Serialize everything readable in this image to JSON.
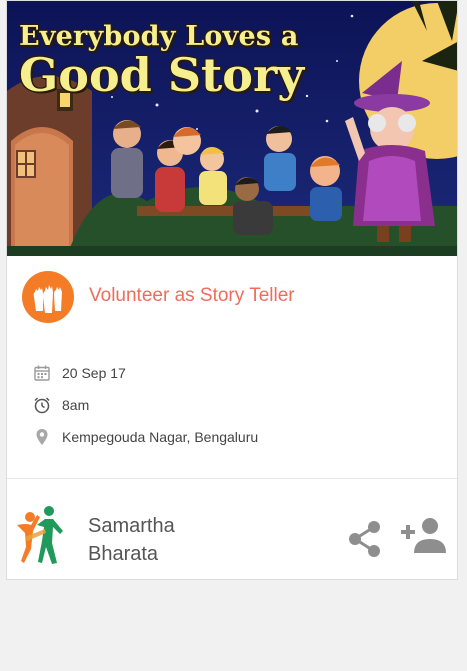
{
  "banner": {
    "title_line1": "Everybody Loves a",
    "title_line2": "Good Story"
  },
  "event": {
    "title": "Volunteer as Story Teller",
    "date": "20 Sep 17",
    "time": "8am",
    "location": "Kempegouda Nagar, Bengaluru"
  },
  "organization": {
    "name_line1": "Samartha",
    "name_line2": "Bharata"
  },
  "icons": {
    "badge": "raised-hands-icon",
    "date": "calendar-icon",
    "time": "alarm-clock-icon",
    "location": "map-pin-icon",
    "share": "share-icon",
    "follow": "add-person-icon"
  },
  "colors": {
    "accent_orange": "#f47c26",
    "title_coral": "#ef6c5d",
    "icon_gray": "#9a9a9a"
  }
}
